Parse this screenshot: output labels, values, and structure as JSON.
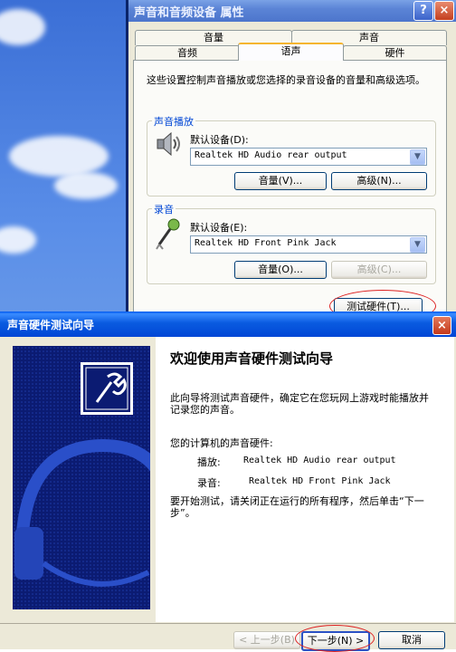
{
  "properties": {
    "title": "声音和音频设备 属性",
    "help_glyph": "?",
    "close_glyph": "×",
    "tabs_row1": [
      "音量",
      "声音"
    ],
    "tabs_row2": [
      "音频",
      "语声",
      "硬件"
    ],
    "active_tab": "语声",
    "description": "这些设置控制声音播放或您选择的录音设备的音量和高级选项。",
    "playback": {
      "group_label": "声音播放",
      "default_label": "默认设备(D):",
      "device": "Realtek HD Audio rear output",
      "volume_button": "音量(V)...",
      "advanced_button": "高级(N)..."
    },
    "recording": {
      "group_label": "录音",
      "default_label": "默认设备(E):",
      "device": "Realtek HD Front Pink Jack",
      "volume_button": "音量(O)...",
      "advanced_button": "高级(C)..."
    },
    "test_hardware_button": "测试硬件(T)..."
  },
  "wizard": {
    "title": "声音硬件测试向导",
    "close_glyph": "×",
    "heading": "欢迎使用声音硬件测试向导",
    "intro": "此向导将测试声音硬件，确定它在您玩网上游戏时能播放并记录您的声音。",
    "hardware_heading": "您的计算机的声音硬件:",
    "playback_label": "播放:",
    "playback_device": "Realtek HD Audio rear output",
    "recording_label": "录音:",
    "recording_device": "Realtek HD Front Pink Jack",
    "instruction": "要开始测试，请关闭正在运行的所有程序，然后单击“下一步”。",
    "back_button": "< 上一步(B)",
    "next_button": "下一步(N) >",
    "cancel_button": "取消"
  },
  "colors": {
    "xp_title_blue": "#0046d5",
    "group_label_blue": "#0046d5",
    "annotation_red": "#dd2222",
    "wizard_banner": "#0b1b72"
  },
  "icons": {
    "speaker": "speaker-icon",
    "microphone": "microphone-icon",
    "wrench": "wrench-icon",
    "headset": "headset-icon",
    "dropdown": "chevron-down-icon"
  }
}
